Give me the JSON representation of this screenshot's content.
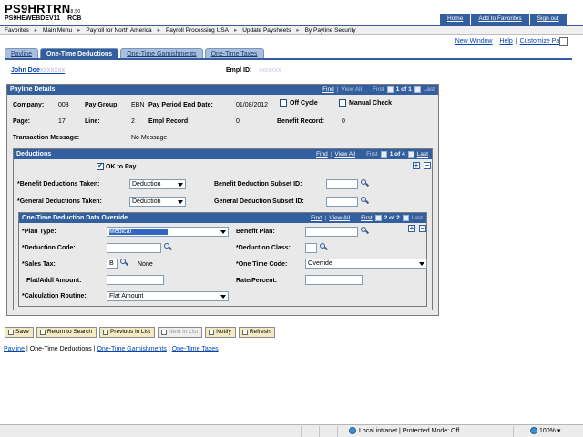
{
  "header": {
    "app_title": "PS9HRTRN",
    "version": "8.50",
    "db_name": "PS9HEWEBDEV11",
    "db_tag": "RCB",
    "top_links": [
      "Home",
      "Add to Favorites",
      "Sign out"
    ]
  },
  "breadcrumb": [
    "Favorites",
    "Main Menu",
    "Payroll for North America",
    "Payroll Processing USA",
    "Update Paysheets",
    "By Payline Security"
  ],
  "page_links": {
    "new_window": "New Window",
    "help": "Help",
    "customize": "Customize Page"
  },
  "tabs": [
    {
      "label": "Payline",
      "active": false
    },
    {
      "label": "One-Time Deductions",
      "active": true
    },
    {
      "label": "One-Time Garnishments",
      "active": false
    },
    {
      "label": "One-Time Taxes",
      "active": false
    }
  ],
  "employee": {
    "name": "John Doe",
    "name_masked": "xxxxxxx",
    "empl_id_label": "Empl ID:",
    "empl_id_masked": "xxxxxxx"
  },
  "payline_details": {
    "title": "Payline Details",
    "nav": {
      "find": "Find",
      "view_all": "View All",
      "first": "First",
      "position": "1 of 1",
      "last": "Last"
    },
    "company_label": "Company:",
    "company": "003",
    "pay_group_label": "Pay Group:",
    "pay_group": "EBN",
    "period_end_label": "Pay Period End Date:",
    "period_end": "01/08/2012",
    "off_cycle_label": "Off Cycle",
    "off_cycle": false,
    "manual_check_label": "Manual Check",
    "manual_check": false,
    "page_label": "Page:",
    "page": "17",
    "line_label": "Line:",
    "line": "2",
    "empl_record_label": "Empl Record:",
    "empl_record": "0",
    "benefit_record_label": "Benefit Record:",
    "benefit_record": "0",
    "transaction_label": "Transaction Message:",
    "transaction": "No Message"
  },
  "deductions": {
    "title": "Deductions",
    "nav": {
      "find": "Find",
      "view_all": "View All",
      "first": "First",
      "position": "1 of 4",
      "last": "Last"
    },
    "ok_to_pay_label": "OK to Pay",
    "ok_to_pay": true,
    "benefit_taken_label": "*Benefit Deductions Taken:",
    "benefit_taken": "Deduction",
    "general_taken_label": "*General Deductions Taken:",
    "general_taken": "Deduction",
    "benefit_subset_label": "Benefit Deduction Subset ID:",
    "benefit_subset": "",
    "general_subset_label": "General Deduction Subset ID:",
    "general_subset": ""
  },
  "override": {
    "title": "One-Time Deduction Data Override",
    "nav": {
      "find": "Find",
      "view_all": "View All",
      "first": "First",
      "position": "2 of 2",
      "last": "Last"
    },
    "plan_type_label": "*Plan Type:",
    "plan_type": "Medical",
    "benefit_plan_label": "Benefit Plan:",
    "benefit_plan": "",
    "deduction_code_label": "*Deduction Code:",
    "deduction_code": "",
    "deduction_class_label": "*Deduction Class:",
    "deduction_class": "",
    "sales_tax_label": "*Sales Tax:",
    "sales_tax": "B",
    "sales_tax_desc": "None",
    "one_time_code_label": "*One Time Code:",
    "one_time_code": "Override",
    "flat_amount_label": "Flat/Addl Amount:",
    "flat_amount": "",
    "rate_label": "Rate/Percent:",
    "rate": "",
    "calc_routine_label": "*Calculation Routine:",
    "calc_routine": "Flat Amount"
  },
  "buttons": [
    "Save",
    "Return to Search",
    "Previous in List",
    "Next in List",
    "Notify",
    "Refresh"
  ],
  "bottom_links": [
    "Payline",
    "One-Time Deductions",
    "One-Time Garnishments",
    "One-Time Taxes"
  ],
  "statusbar": {
    "zone": "Local intranet | Protected Mode: Off",
    "zoom": "100%"
  }
}
